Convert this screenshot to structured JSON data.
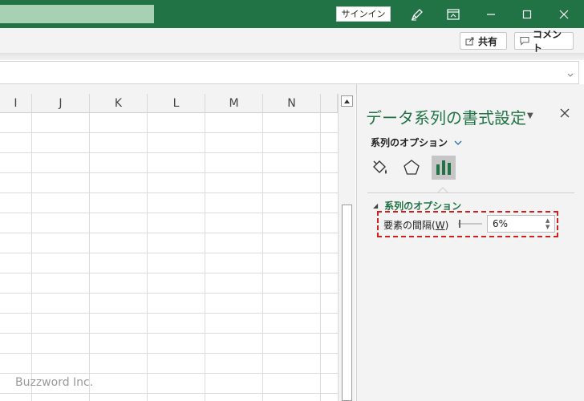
{
  "titlebar": {
    "signin_label": "サインイン"
  },
  "ribbon": {
    "share_label": "共有",
    "comment_label": "コメント"
  },
  "grid": {
    "columns": [
      "I",
      "J",
      "K",
      "L",
      "M",
      "N"
    ]
  },
  "format_pane": {
    "title": "データ系列の書式設定",
    "options_label": "系列のオプション",
    "section_label": "系列のオプション",
    "gap_width_label": "要素の間隔(",
    "gap_width_hotkey": "W",
    "gap_width_label_end": ")",
    "gap_width_value": "6%",
    "active_tab": "series-options-icon"
  },
  "watermark": "Buzzword Inc.",
  "colors": {
    "titlebar_bg": "#217346",
    "accent_green": "#217346",
    "highlight_red": "#d21f1f"
  }
}
